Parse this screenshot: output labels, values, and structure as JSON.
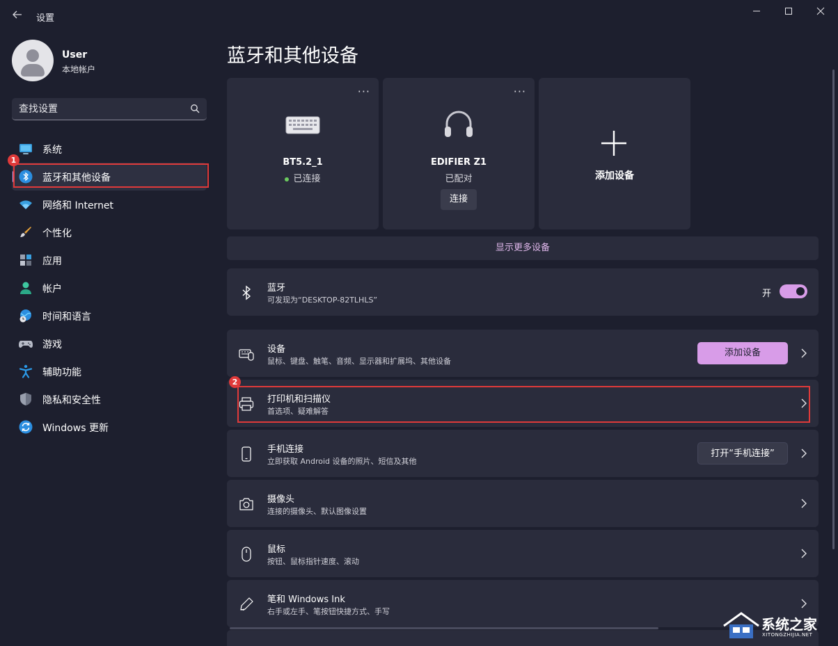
{
  "window": {
    "title": "设置",
    "controls": {
      "minimize": "—",
      "maximize": "☐",
      "close": "✕"
    }
  },
  "profile": {
    "name": "User",
    "account_type": "本地帐户"
  },
  "search": {
    "placeholder": "查找设置"
  },
  "sidebar": {
    "items": [
      {
        "label": "系统",
        "icon": "monitor-icon"
      },
      {
        "label": "蓝牙和其他设备",
        "icon": "bluetooth-icon",
        "selected": true
      },
      {
        "label": "网络和 Internet",
        "icon": "wifi-icon"
      },
      {
        "label": "个性化",
        "icon": "brush-icon"
      },
      {
        "label": "应用",
        "icon": "apps-icon"
      },
      {
        "label": "帐户",
        "icon": "person-icon"
      },
      {
        "label": "时间和语言",
        "icon": "globe-clock-icon"
      },
      {
        "label": "游戏",
        "icon": "gamepad-icon"
      },
      {
        "label": "辅助功能",
        "icon": "accessibility-icon"
      },
      {
        "label": "隐私和安全性",
        "icon": "shield-icon"
      },
      {
        "label": "Windows 更新",
        "icon": "update-icon"
      }
    ]
  },
  "annotations": {
    "marker1": "1",
    "marker2": "2"
  },
  "main": {
    "title": "蓝牙和其他设备",
    "devices": [
      {
        "name": "BT5.2_1",
        "status": "已连接",
        "connected": true,
        "icon": "keyboard-icon",
        "more": "···"
      },
      {
        "name": "EDIFIER Z1",
        "status": "已配对",
        "connected": false,
        "icon": "headset-icon",
        "more": "···",
        "action": "连接"
      }
    ],
    "add_device_card": {
      "label": "添加设备",
      "icon": "plus-icon"
    },
    "show_more": "显示更多设备",
    "bluetooth": {
      "title": "蓝牙",
      "subtitle": "可发现为“DESKTOP-82TLHLS”",
      "toggle_label": "开",
      "on": true
    },
    "rows": [
      {
        "title": "设备",
        "subtitle": "鼠标、键盘、触笔、音频、显示器和扩展坞、其他设备",
        "button": "添加设备",
        "icon": "devices-icon"
      },
      {
        "title": "打印机和扫描仪",
        "subtitle": "首选项、疑难解答",
        "icon": "printer-icon"
      },
      {
        "title": "手机连接",
        "subtitle": "立即获取 Android 设备的照片、短信及其他",
        "button": "打开“手机连接”",
        "icon": "phone-icon"
      },
      {
        "title": "摄像头",
        "subtitle": "连接的摄像头、默认图像设置",
        "icon": "camera-icon"
      },
      {
        "title": "鼠标",
        "subtitle": "按钮、鼠标指针速度、滚动",
        "icon": "mouse-icon"
      },
      {
        "title": "笔和 Windows Ink",
        "subtitle": "右手或左手、笔按钮快捷方式、手写",
        "icon": "pen-icon"
      }
    ]
  },
  "watermark": {
    "text": "系统之家",
    "url": "XITONGZHIJIA.NET"
  },
  "colors": {
    "background": "#1d1f2e",
    "card": "#2a2c3c",
    "accent": "#d89ce8",
    "annotation": "#e03a3a"
  }
}
